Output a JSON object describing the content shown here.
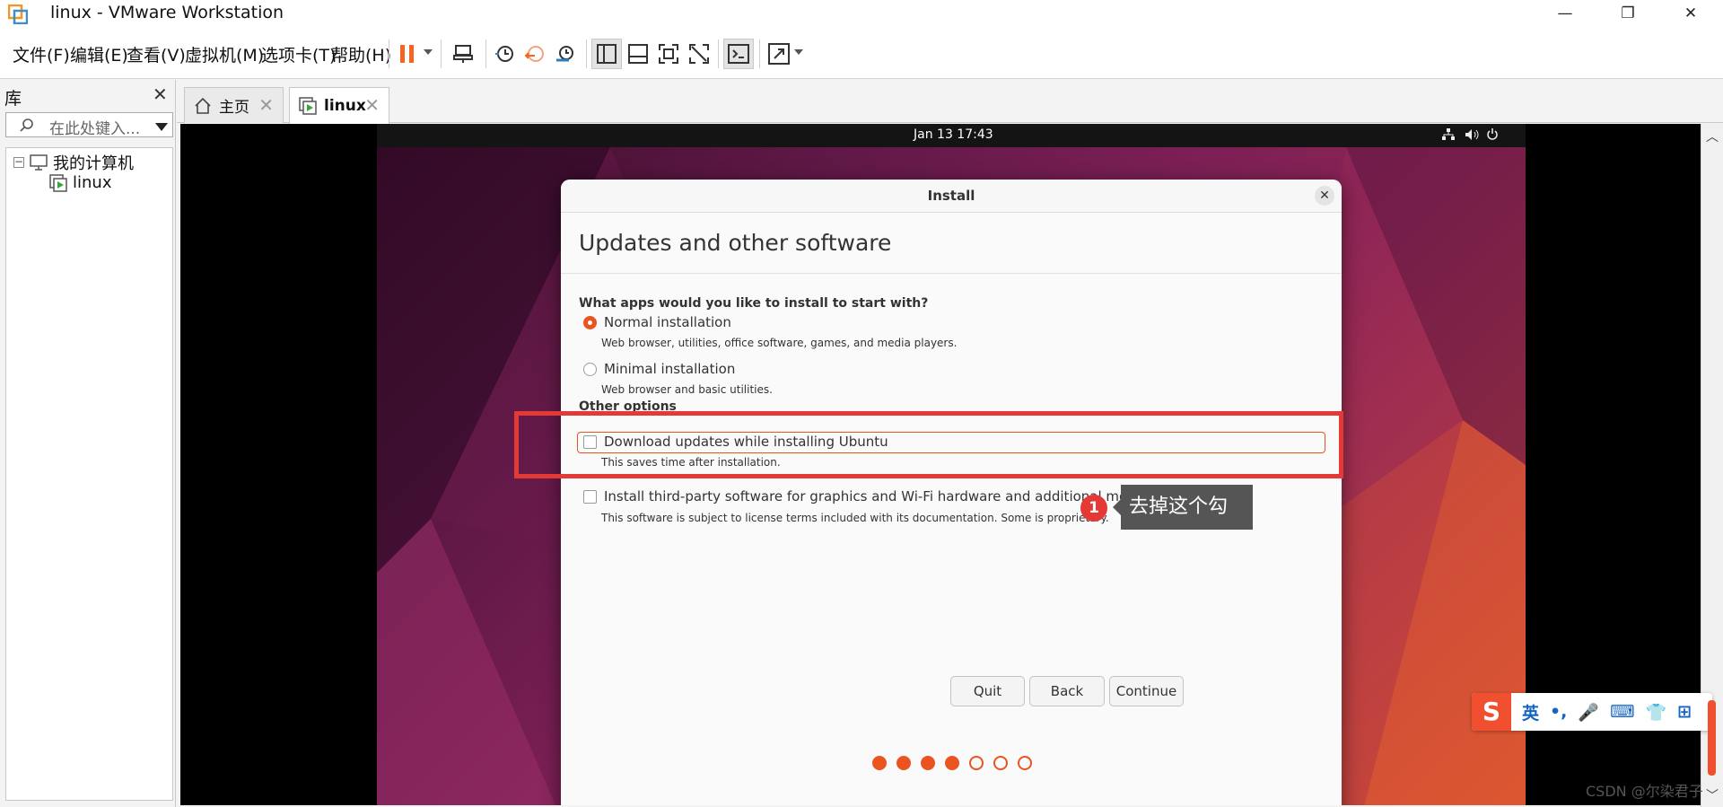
{
  "window": {
    "title": "linux - VMware Workstation",
    "minimize": "—",
    "restore": "❐",
    "close": "✕"
  },
  "menu": [
    "文件(F)",
    "编辑(E)",
    "查看(V)",
    "虚拟机(M)",
    "选项卡(T)",
    "帮助(H)"
  ],
  "toolbar": {
    "icons": [
      "pause-icon",
      "send-ctrl-alt-del-icon",
      "snapshot-icon",
      "revert-snapshot-icon",
      "snapshot-manager-icon",
      "library-view-icon",
      "thumbnail-view-icon",
      "fullscreen-icon",
      "unity-icon",
      "console-icon",
      "stretch-icon"
    ],
    "accent": "#f26522"
  },
  "library": {
    "title": "库",
    "close": "✕",
    "search_placeholder": "在此处键入...",
    "tree_root": "我的计算机",
    "tree_child": "linux",
    "toggle": "−"
  },
  "tabs": [
    {
      "label": "主页",
      "icon": "home-icon",
      "close": "✕"
    },
    {
      "label": "linux",
      "icon": "vm-icon",
      "close": "✕"
    }
  ],
  "guest": {
    "clock": "Jan 13  17:43",
    "tray_icons": [
      "network-icon",
      "volume-icon",
      "power-icon"
    ],
    "installer": {
      "title": "Install",
      "close": "✕",
      "heading": "Updates and other software",
      "section1": "What apps would you like to install to start with?",
      "normal_label": "Normal installation",
      "normal_desc": "Web browser, utilities, office software, games, and media players.",
      "minimal_label": "Minimal installation",
      "minimal_desc": "Web browser and basic utilities.",
      "section2": "Other options",
      "updates_label": "Download updates while installing Ubuntu",
      "updates_desc": "This saves time after installation.",
      "thirdparty_label": "Install third-party software for graphics and Wi-Fi hardware and additional media formats",
      "thirdparty_desc": "This software is subject to license terms included with its documentation. Some is proprietary.",
      "quit": "Quit",
      "back": "Back",
      "continue": "Continue",
      "progress_step": 4,
      "progress_total": 7,
      "accent": "#e95420"
    }
  },
  "annotation": {
    "marker": "1",
    "tooltip": "去掉这个勾",
    "highlight_color": "#e53935"
  },
  "ime": {
    "logo": "S",
    "items": [
      "英",
      "•,",
      "🎤",
      "⌨",
      "👕",
      "⊞"
    ]
  },
  "watermark": "CSDN @尔染君子"
}
